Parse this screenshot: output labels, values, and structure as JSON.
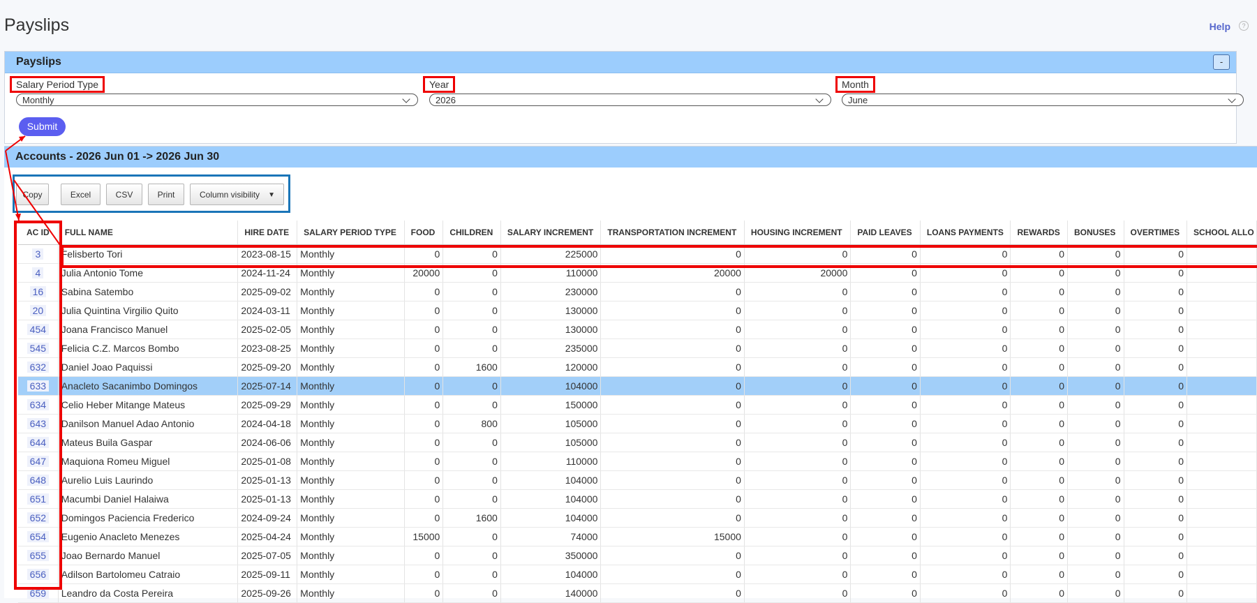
{
  "header": {
    "title": "Payslips",
    "help": "Help",
    "help_icon": "question-circle"
  },
  "filter_panel": {
    "title": "Payslips",
    "collapse_label": "-",
    "salary_period_type": {
      "label": "Salary Period Type",
      "value": "Monthly"
    },
    "year": {
      "label": "Year",
      "value": "2026"
    },
    "month": {
      "label": "Month",
      "value": "June"
    },
    "submit_label": "Submit"
  },
  "accounts": {
    "title": "Accounts - 2026 Jun 01 -> 2026 Jun 30",
    "buttons": {
      "copy": "Copy",
      "excel": "Excel",
      "csv": "CSV",
      "print": "Print",
      "column_visibility": "Column visibility"
    },
    "columns": [
      "AC ID",
      "FULL NAME",
      "HIRE DATE",
      "SALARY PERIOD TYPE",
      "FOOD",
      "CHILDREN",
      "SALARY INCREMENT",
      "TRANSPORTATION INCREMENT",
      "HOUSING INCREMENT",
      "PAID LEAVES",
      "LOANS PAYMENTS",
      "REWARDS",
      "BONUSES",
      "OVERTIMES",
      "SCHOOL ALLO"
    ],
    "rows": [
      [
        "3",
        "Felisberto Tori",
        "2023-08-15",
        "Monthly",
        "0",
        "0",
        "225000",
        "0",
        "0",
        "0",
        "0",
        "0",
        "0",
        "0",
        ""
      ],
      [
        "4",
        "Julia Antonio Tome",
        "2024-11-24",
        "Monthly",
        "20000",
        "0",
        "110000",
        "20000",
        "20000",
        "0",
        "0",
        "0",
        "0",
        "0",
        ""
      ],
      [
        "16",
        "Sabina Satembo",
        "2025-09-02",
        "Monthly",
        "0",
        "0",
        "230000",
        "0",
        "0",
        "0",
        "0",
        "0",
        "0",
        "0",
        ""
      ],
      [
        "20",
        "Julia Quintina Virgilio Quito",
        "2024-03-11",
        "Monthly",
        "0",
        "0",
        "130000",
        "0",
        "0",
        "0",
        "0",
        "0",
        "0",
        "0",
        ""
      ],
      [
        "454",
        "Joana Francisco Manuel",
        "2025-02-05",
        "Monthly",
        "0",
        "0",
        "130000",
        "0",
        "0",
        "0",
        "0",
        "0",
        "0",
        "0",
        ""
      ],
      [
        "545",
        "Felicia C.Z. Marcos Bombo",
        "2023-08-25",
        "Monthly",
        "0",
        "0",
        "235000",
        "0",
        "0",
        "0",
        "0",
        "0",
        "0",
        "0",
        ""
      ],
      [
        "632",
        "Daniel Joao Paquissi",
        "2025-09-20",
        "Monthly",
        "0",
        "1600",
        "120000",
        "0",
        "0",
        "0",
        "0",
        "0",
        "0",
        "0",
        ""
      ],
      [
        "633",
        "Anacleto Sacanimbo Domingos",
        "2025-07-14",
        "Monthly",
        "0",
        "0",
        "104000",
        "0",
        "0",
        "0",
        "0",
        "0",
        "0",
        "0",
        ""
      ],
      [
        "634",
        "Celio Heber Mitange Mateus",
        "2025-09-29",
        "Monthly",
        "0",
        "0",
        "150000",
        "0",
        "0",
        "0",
        "0",
        "0",
        "0",
        "0",
        ""
      ],
      [
        "643",
        "Danilson Manuel Adao Antonio",
        "2024-04-18",
        "Monthly",
        "0",
        "800",
        "105000",
        "0",
        "0",
        "0",
        "0",
        "0",
        "0",
        "0",
        ""
      ],
      [
        "644",
        "Mateus Buila Gaspar",
        "2024-06-06",
        "Monthly",
        "0",
        "0",
        "105000",
        "0",
        "0",
        "0",
        "0",
        "0",
        "0",
        "0",
        ""
      ],
      [
        "647",
        "Maquiona Romeu Miguel",
        "2025-01-08",
        "Monthly",
        "0",
        "0",
        "110000",
        "0",
        "0",
        "0",
        "0",
        "0",
        "0",
        "0",
        ""
      ],
      [
        "648",
        "Aurelio Luis Laurindo",
        "2025-01-13",
        "Monthly",
        "0",
        "0",
        "104000",
        "0",
        "0",
        "0",
        "0",
        "0",
        "0",
        "0",
        ""
      ],
      [
        "651",
        "Macumbi Daniel Halaiwa",
        "2025-01-13",
        "Monthly",
        "0",
        "0",
        "104000",
        "0",
        "0",
        "0",
        "0",
        "0",
        "0",
        "0",
        ""
      ],
      [
        "652",
        "Domingos Paciencia Frederico",
        "2024-09-24",
        "Monthly",
        "0",
        "1600",
        "104000",
        "0",
        "0",
        "0",
        "0",
        "0",
        "0",
        "0",
        ""
      ],
      [
        "654",
        "Eugenio Anacleto Menezes",
        "2025-04-24",
        "Monthly",
        "15000",
        "0",
        "74000",
        "15000",
        "0",
        "0",
        "0",
        "0",
        "0",
        "0",
        ""
      ],
      [
        "655",
        "Joao Bernardo Manuel",
        "2025-07-05",
        "Monthly",
        "0",
        "0",
        "350000",
        "0",
        "0",
        "0",
        "0",
        "0",
        "0",
        "0",
        ""
      ],
      [
        "656",
        "Adilson Bartolomeu Catraio",
        "2025-09-11",
        "Monthly",
        "0",
        "0",
        "104000",
        "0",
        "0",
        "0",
        "0",
        "0",
        "0",
        "0",
        ""
      ],
      [
        "659",
        "Leandro da Costa Pereira",
        "2025-09-26",
        "Monthly",
        "0",
        "0",
        "140000",
        "0",
        "0",
        "0",
        "0",
        "0",
        "0",
        "0",
        ""
      ]
    ],
    "selected_row_id": "633"
  }
}
